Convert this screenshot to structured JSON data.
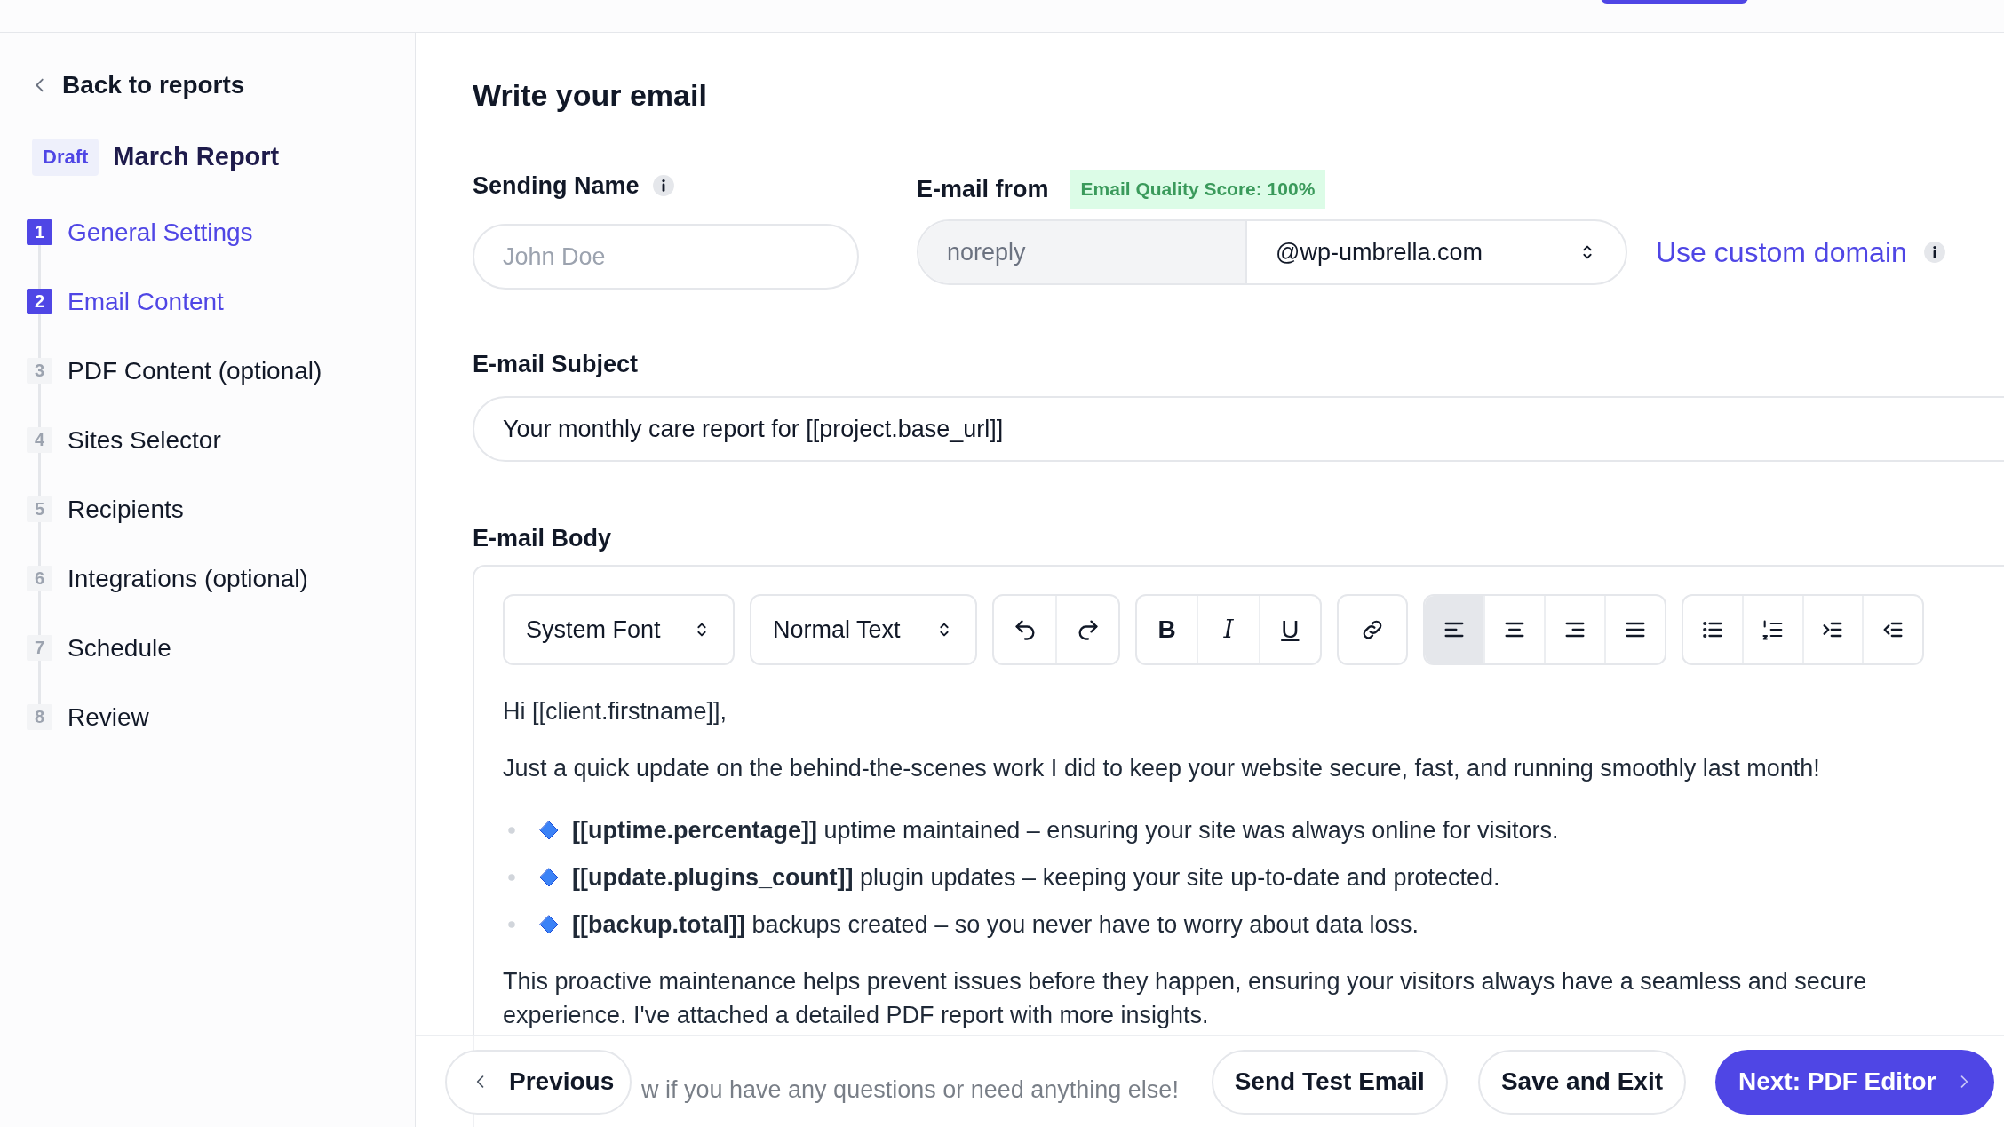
{
  "sidebar": {
    "back_link": "Back to reports",
    "badge": "Draft",
    "report_title": "March Report",
    "steps": [
      {
        "number": "1",
        "label": "General Settings",
        "completed": true
      },
      {
        "number": "2",
        "label": "Email Content",
        "completed": true
      },
      {
        "number": "3",
        "label": "PDF Content (optional)",
        "completed": false
      },
      {
        "number": "4",
        "label": "Sites Selector",
        "completed": false
      },
      {
        "number": "5",
        "label": "Recipients",
        "completed": false
      },
      {
        "number": "6",
        "label": "Integrations (optional)",
        "completed": false
      },
      {
        "number": "7",
        "label": "Schedule",
        "completed": false
      },
      {
        "number": "8",
        "label": "Review",
        "completed": false
      }
    ]
  },
  "main": {
    "title": "Write your email",
    "sending_name": {
      "label": "Sending Name",
      "placeholder": "John Doe"
    },
    "email_from": {
      "label": "E-mail from",
      "badge": "Email Quality Score: 100%",
      "local_part": "noreply",
      "domain": "@wp-umbrella.com",
      "custom_domain_link": "Use custom domain"
    },
    "subject": {
      "label": "E-mail Subject",
      "value": "Your monthly care report for [[project.base_url]]"
    },
    "body": {
      "label": "E-mail Body",
      "toolbar": {
        "font": "System Font",
        "text_style": "Normal Text",
        "format_buttons": [
          {
            "kind": "bold",
            "label": "B"
          },
          {
            "kind": "italic",
            "label": "I"
          },
          {
            "kind": "underline",
            "label": "U"
          }
        ],
        "align_buttons": [
          {
            "kind": "left",
            "selected": true
          },
          {
            "kind": "center",
            "selected": false
          },
          {
            "kind": "right",
            "selected": false
          },
          {
            "kind": "justify",
            "selected": false
          }
        ]
      },
      "paragraphs": [
        {
          "kind": "text",
          "text": "Hi [[client.firstname]],"
        },
        {
          "kind": "text",
          "text": "Just a quick update on the behind-the-scenes work I did to keep your website secure, fast, and running smoothly last month!"
        },
        {
          "kind": "bullet",
          "text": "**[[uptime.percentage]]** uptime maintained – ensuring your site was always online for visitors."
        },
        {
          "kind": "bullet",
          "text": "**[[update.plugins_count]]** plugin updates – keeping your site up-to-date and protected."
        },
        {
          "kind": "bullet",
          "text": "**[[backup.total]]** backups created – so you never have to worry about data loss."
        },
        {
          "kind": "text",
          "text": "This proactive maintenance helps prevent issues before they happen, ensuring your visitors always have a seamless and secure experience. I've attached a detailed PDF report with more insights."
        },
        {
          "kind": "partial",
          "text": "w if you have any questions or need anything else!"
        }
      ]
    }
  },
  "footer": {
    "buttons": [
      {
        "kind": "back",
        "label": "Previous"
      },
      {
        "kind": "secondary",
        "label": "Send Test Email"
      },
      {
        "kind": "secondary",
        "label": "Save and Exit"
      },
      {
        "kind": "primary",
        "label": "Next: PDF Editor"
      }
    ]
  }
}
